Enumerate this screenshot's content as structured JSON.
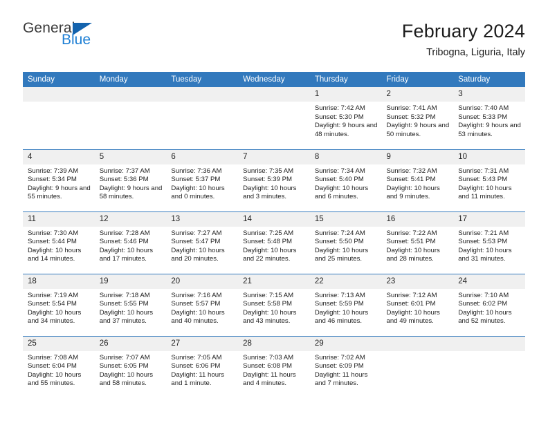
{
  "logo": {
    "word_one": "General",
    "word_two": "Blue",
    "triangle_icon": "triangle-icon",
    "accent_color": "#1463ad",
    "blue_text_color": "#1e7fd4"
  },
  "header": {
    "title": "February 2024",
    "subtitle": "Tribogna, Liguria, Italy",
    "header_bg_color": "#3279bd",
    "daynum_bg_color": "#f0f0f0"
  },
  "weekday_headers": [
    "Sunday",
    "Monday",
    "Tuesday",
    "Wednesday",
    "Thursday",
    "Friday",
    "Saturday"
  ],
  "weeks": [
    [
      {
        "day": "",
        "sunrise": "",
        "sunset": "",
        "daylight": "",
        "empty": true
      },
      {
        "day": "",
        "sunrise": "",
        "sunset": "",
        "daylight": "",
        "empty": true
      },
      {
        "day": "",
        "sunrise": "",
        "sunset": "",
        "daylight": "",
        "empty": true
      },
      {
        "day": "",
        "sunrise": "",
        "sunset": "",
        "daylight": "",
        "empty": true
      },
      {
        "day": "1",
        "sunrise": "Sunrise: 7:42 AM",
        "sunset": "Sunset: 5:30 PM",
        "daylight": "Daylight: 9 hours and 48 minutes.",
        "empty": false
      },
      {
        "day": "2",
        "sunrise": "Sunrise: 7:41 AM",
        "sunset": "Sunset: 5:32 PM",
        "daylight": "Daylight: 9 hours and 50 minutes.",
        "empty": false
      },
      {
        "day": "3",
        "sunrise": "Sunrise: 7:40 AM",
        "sunset": "Sunset: 5:33 PM",
        "daylight": "Daylight: 9 hours and 53 minutes.",
        "empty": false
      }
    ],
    [
      {
        "day": "4",
        "sunrise": "Sunrise: 7:39 AM",
        "sunset": "Sunset: 5:34 PM",
        "daylight": "Daylight: 9 hours and 55 minutes.",
        "empty": false
      },
      {
        "day": "5",
        "sunrise": "Sunrise: 7:37 AM",
        "sunset": "Sunset: 5:36 PM",
        "daylight": "Daylight: 9 hours and 58 minutes.",
        "empty": false
      },
      {
        "day": "6",
        "sunrise": "Sunrise: 7:36 AM",
        "sunset": "Sunset: 5:37 PM",
        "daylight": "Daylight: 10 hours and 0 minutes.",
        "empty": false
      },
      {
        "day": "7",
        "sunrise": "Sunrise: 7:35 AM",
        "sunset": "Sunset: 5:39 PM",
        "daylight": "Daylight: 10 hours and 3 minutes.",
        "empty": false
      },
      {
        "day": "8",
        "sunrise": "Sunrise: 7:34 AM",
        "sunset": "Sunset: 5:40 PM",
        "daylight": "Daylight: 10 hours and 6 minutes.",
        "empty": false
      },
      {
        "day": "9",
        "sunrise": "Sunrise: 7:32 AM",
        "sunset": "Sunset: 5:41 PM",
        "daylight": "Daylight: 10 hours and 9 minutes.",
        "empty": false
      },
      {
        "day": "10",
        "sunrise": "Sunrise: 7:31 AM",
        "sunset": "Sunset: 5:43 PM",
        "daylight": "Daylight: 10 hours and 11 minutes.",
        "empty": false
      }
    ],
    [
      {
        "day": "11",
        "sunrise": "Sunrise: 7:30 AM",
        "sunset": "Sunset: 5:44 PM",
        "daylight": "Daylight: 10 hours and 14 minutes.",
        "empty": false
      },
      {
        "day": "12",
        "sunrise": "Sunrise: 7:28 AM",
        "sunset": "Sunset: 5:46 PM",
        "daylight": "Daylight: 10 hours and 17 minutes.",
        "empty": false
      },
      {
        "day": "13",
        "sunrise": "Sunrise: 7:27 AM",
        "sunset": "Sunset: 5:47 PM",
        "daylight": "Daylight: 10 hours and 20 minutes.",
        "empty": false
      },
      {
        "day": "14",
        "sunrise": "Sunrise: 7:25 AM",
        "sunset": "Sunset: 5:48 PM",
        "daylight": "Daylight: 10 hours and 22 minutes.",
        "empty": false
      },
      {
        "day": "15",
        "sunrise": "Sunrise: 7:24 AM",
        "sunset": "Sunset: 5:50 PM",
        "daylight": "Daylight: 10 hours and 25 minutes.",
        "empty": false
      },
      {
        "day": "16",
        "sunrise": "Sunrise: 7:22 AM",
        "sunset": "Sunset: 5:51 PM",
        "daylight": "Daylight: 10 hours and 28 minutes.",
        "empty": false
      },
      {
        "day": "17",
        "sunrise": "Sunrise: 7:21 AM",
        "sunset": "Sunset: 5:53 PM",
        "daylight": "Daylight: 10 hours and 31 minutes.",
        "empty": false
      }
    ],
    [
      {
        "day": "18",
        "sunrise": "Sunrise: 7:19 AM",
        "sunset": "Sunset: 5:54 PM",
        "daylight": "Daylight: 10 hours and 34 minutes.",
        "empty": false
      },
      {
        "day": "19",
        "sunrise": "Sunrise: 7:18 AM",
        "sunset": "Sunset: 5:55 PM",
        "daylight": "Daylight: 10 hours and 37 minutes.",
        "empty": false
      },
      {
        "day": "20",
        "sunrise": "Sunrise: 7:16 AM",
        "sunset": "Sunset: 5:57 PM",
        "daylight": "Daylight: 10 hours and 40 minutes.",
        "empty": false
      },
      {
        "day": "21",
        "sunrise": "Sunrise: 7:15 AM",
        "sunset": "Sunset: 5:58 PM",
        "daylight": "Daylight: 10 hours and 43 minutes.",
        "empty": false
      },
      {
        "day": "22",
        "sunrise": "Sunrise: 7:13 AM",
        "sunset": "Sunset: 5:59 PM",
        "daylight": "Daylight: 10 hours and 46 minutes.",
        "empty": false
      },
      {
        "day": "23",
        "sunrise": "Sunrise: 7:12 AM",
        "sunset": "Sunset: 6:01 PM",
        "daylight": "Daylight: 10 hours and 49 minutes.",
        "empty": false
      },
      {
        "day": "24",
        "sunrise": "Sunrise: 7:10 AM",
        "sunset": "Sunset: 6:02 PM",
        "daylight": "Daylight: 10 hours and 52 minutes.",
        "empty": false
      }
    ],
    [
      {
        "day": "25",
        "sunrise": "Sunrise: 7:08 AM",
        "sunset": "Sunset: 6:04 PM",
        "daylight": "Daylight: 10 hours and 55 minutes.",
        "empty": false
      },
      {
        "day": "26",
        "sunrise": "Sunrise: 7:07 AM",
        "sunset": "Sunset: 6:05 PM",
        "daylight": "Daylight: 10 hours and 58 minutes.",
        "empty": false
      },
      {
        "day": "27",
        "sunrise": "Sunrise: 7:05 AM",
        "sunset": "Sunset: 6:06 PM",
        "daylight": "Daylight: 11 hours and 1 minute.",
        "empty": false
      },
      {
        "day": "28",
        "sunrise": "Sunrise: 7:03 AM",
        "sunset": "Sunset: 6:08 PM",
        "daylight": "Daylight: 11 hours and 4 minutes.",
        "empty": false
      },
      {
        "day": "29",
        "sunrise": "Sunrise: 7:02 AM",
        "sunset": "Sunset: 6:09 PM",
        "daylight": "Daylight: 11 hours and 7 minutes.",
        "empty": false
      },
      {
        "day": "",
        "sunrise": "",
        "sunset": "",
        "daylight": "",
        "empty": true
      },
      {
        "day": "",
        "sunrise": "",
        "sunset": "",
        "daylight": "",
        "empty": true
      }
    ]
  ]
}
